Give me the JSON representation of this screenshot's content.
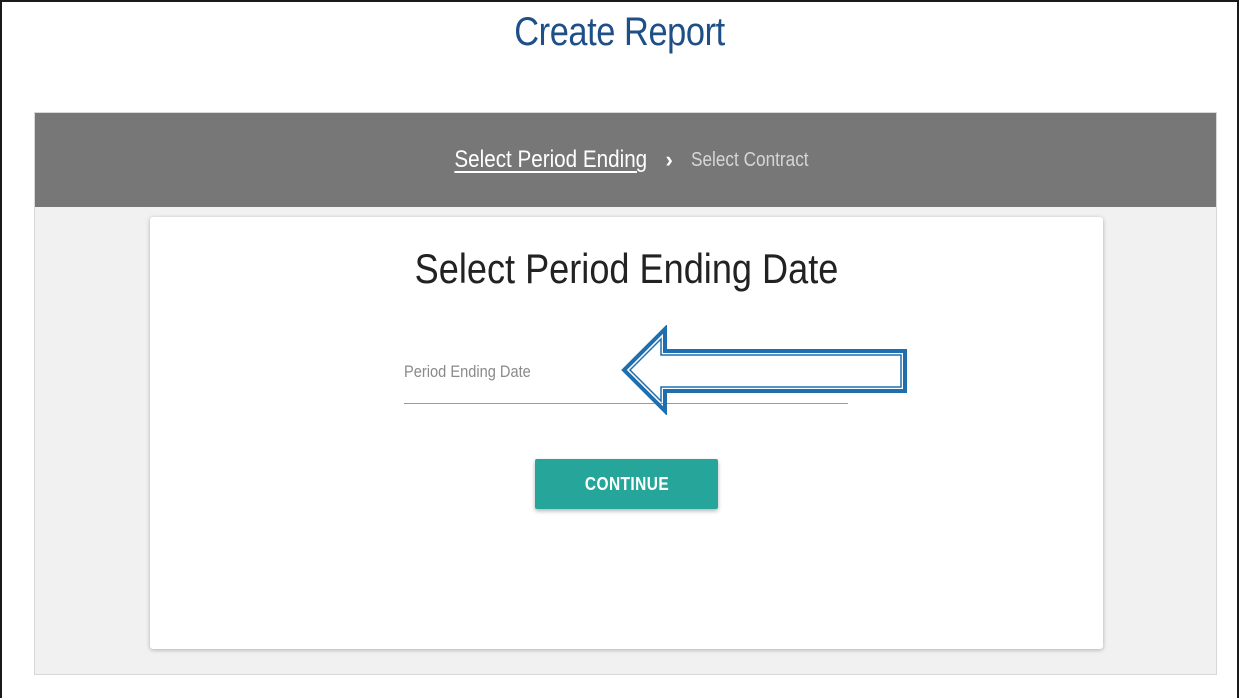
{
  "page": {
    "title": "Create Report"
  },
  "stepper": {
    "steps": [
      {
        "label": "Select Period Ending",
        "active": true
      },
      {
        "label": "Select Contract",
        "active": false
      }
    ],
    "separator_icon": "chevron-right-icon"
  },
  "card": {
    "title": "Select Period Ending Date",
    "date_field": {
      "placeholder": "Period Ending Date",
      "value": ""
    },
    "continue_label": "CONTINUE"
  },
  "colors": {
    "title_blue": "#1e4f86",
    "stepper_bg": "#777777",
    "button_teal": "#26a69a",
    "annotation_blue": "#1f6fae"
  }
}
